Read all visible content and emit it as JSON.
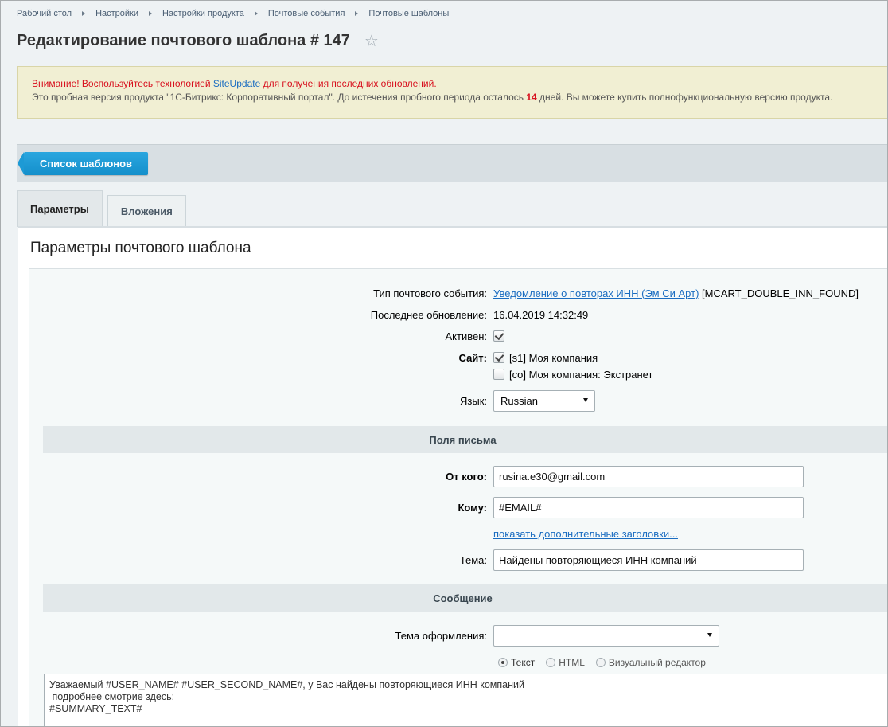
{
  "breadcrumb": [
    "Рабочий стол",
    "Настройки",
    "Настройки продукта",
    "Почтовые события",
    "Почтовые шаблоны"
  ],
  "page_title": "Редактирование почтового шаблона # 147",
  "notice": {
    "warn_prefix": "Внимание! Воспользуйтесь технологией ",
    "warn_link": "SiteUpdate",
    "warn_suffix": " для получения последних обновлений.",
    "trial_prefix": "Это пробная версия продукта \"1С-Битрикс: Корпоративный портал\". До истечения пробного периода осталось ",
    "trial_days": "14",
    "trial_suffix": " дней. Вы можете купить полнофункциональную версию продукта."
  },
  "toolbar": {
    "back_label": "Список шаблонов"
  },
  "tabs": [
    {
      "label": "Параметры",
      "active": true
    },
    {
      "label": "Вложения",
      "active": false
    }
  ],
  "panel_title": "Параметры почтового шаблона",
  "form": {
    "event_type_label": "Тип почтового события:",
    "event_type_link": "Уведомление о повторах ИНН (Эм Си Арт)",
    "event_type_code": " [MCART_DOUBLE_INN_FOUND]",
    "updated_label": "Последнее обновление:",
    "updated_value": "16.04.2019 14:32:49",
    "active_label": "Активен:",
    "active_checked": true,
    "site_label": "Сайт:",
    "sites": [
      {
        "label": "[s1] Моя компания",
        "checked": true
      },
      {
        "label": "[co] Моя компания: Экстранет",
        "checked": false
      }
    ],
    "lang_label": "Язык:",
    "lang_value": "Russian",
    "fields_section": "Поля письма",
    "from_label": "От кого:",
    "from_value": "rusina.e30@gmail.com",
    "to_label": "Кому:",
    "to_value": "#EMAIL#",
    "extra_headers_link": "показать дополнительные заголовки...",
    "subject_label": "Тема:",
    "subject_value": "Найдены повторяющиеся ИНН компаний",
    "message_section": "Сообщение",
    "theme_label": "Тема оформления:",
    "theme_value": "",
    "format_options": [
      {
        "label": "Текст",
        "selected": true
      },
      {
        "label": "HTML",
        "selected": false
      },
      {
        "label": "Визуальный редактор",
        "selected": false
      }
    ],
    "body_text": "Уважаемый #USER_NAME# #USER_SECOND_NAME#, у Вас найдены повторяющиеся ИНН компаний\n подробнее смотрие здесь:\n#SUMMARY_TEXT#"
  },
  "colors": {
    "accent": "#1b9bd7",
    "link": "#1b6dc1",
    "warning": "#d8101e",
    "notice_bg": "#f1efd3"
  }
}
